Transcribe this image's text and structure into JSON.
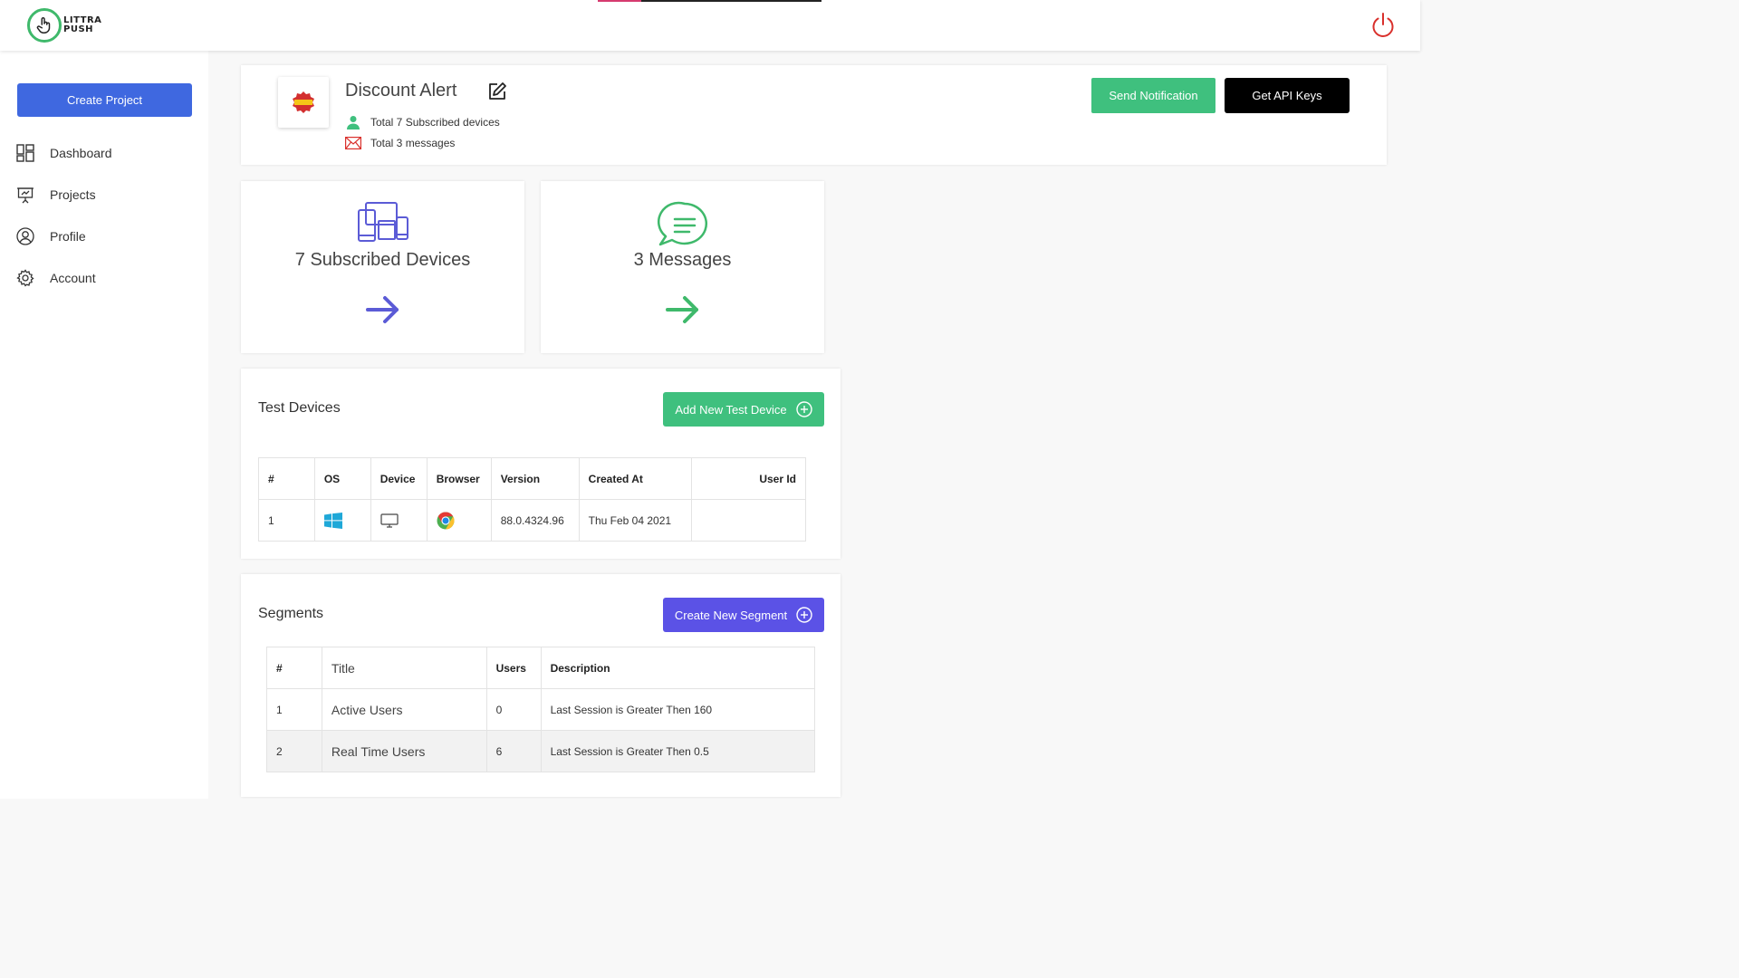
{
  "header": {
    "logo_text_line1": "LITTRA",
    "logo_text_line2": "PUSH",
    "power_icon": "power-icon"
  },
  "sidebar": {
    "create_project_label": "Create Project",
    "items": [
      {
        "label": "Dashboard",
        "icon": "dashboard-icon"
      },
      {
        "label": "Projects",
        "icon": "presentation-icon"
      },
      {
        "label": "Profile",
        "icon": "user-circle-icon"
      },
      {
        "label": "Account",
        "icon": "gear-icon"
      }
    ]
  },
  "project": {
    "title": "Discount Alert",
    "subscribed_text": "Total 7 Subscribed devices",
    "messages_text": "Total 3 messages",
    "send_notification_label": "Send Notification",
    "api_keys_label": "Get API Keys"
  },
  "stats": {
    "devices_label": "7 Subscribed Devices",
    "messages_label": "3 Messages"
  },
  "test_devices": {
    "title": "Test Devices",
    "add_label": "Add New Test Device",
    "columns": [
      "#",
      "OS",
      "Device",
      "Browser",
      "Version",
      "Created At",
      "User Id"
    ],
    "rows": [
      {
        "num": "1",
        "os_icon": "windows-icon",
        "device_icon": "desktop-icon",
        "browser_icon": "chrome-icon",
        "version": "88.0.4324.96",
        "created_at": "Thu Feb 04 2021",
        "user_id": ""
      }
    ]
  },
  "segments": {
    "title": "Segments",
    "add_label": "Create New Segment",
    "columns": [
      "#",
      "Title",
      "Users",
      "Description"
    ],
    "rows": [
      {
        "num": "1",
        "title": "Active Users",
        "users": "0",
        "description": "Last Session is Greater Then 160"
      },
      {
        "num": "2",
        "title": "Real Time Users",
        "users": "6",
        "description": "Last Session is Greater Then 0.5"
      }
    ]
  },
  "colors": {
    "primary_blue": "#3f68e0",
    "green": "#3fc07e",
    "purple_button": "#5b52e6",
    "power_red": "#d9302c"
  }
}
